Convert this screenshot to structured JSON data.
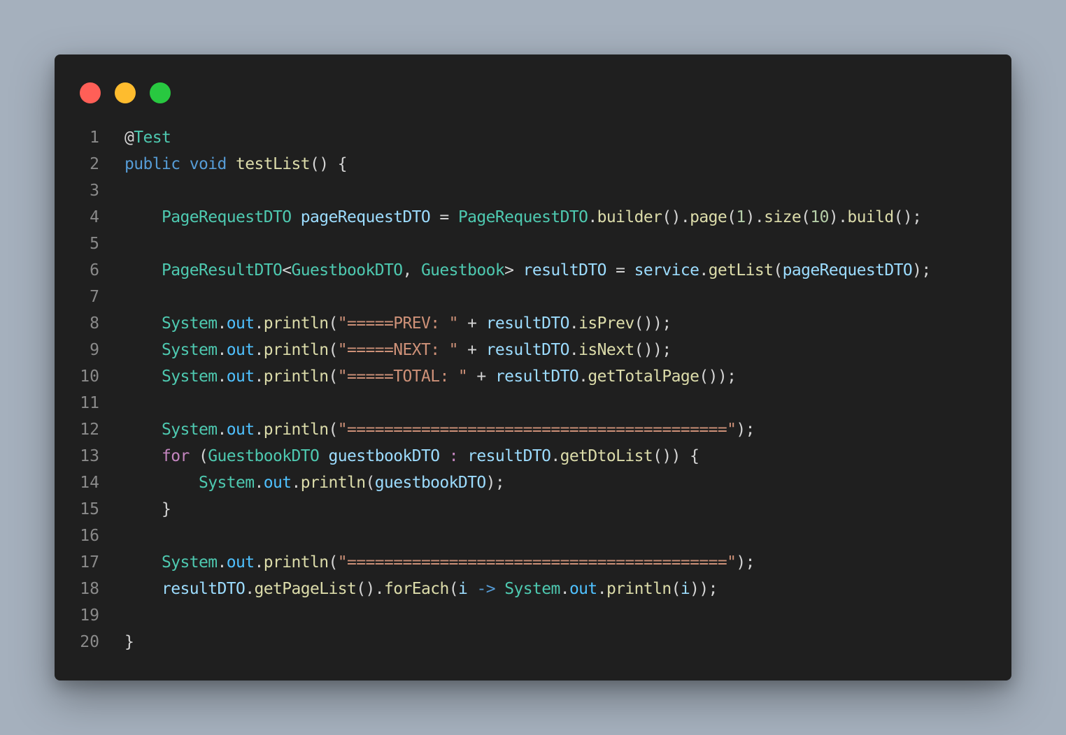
{
  "window": {
    "buttons": [
      {
        "name": "close",
        "color": "#ff5f57"
      },
      {
        "name": "minimize",
        "color": "#febc2e"
      },
      {
        "name": "maximize",
        "color": "#28c840"
      }
    ]
  },
  "colors": {
    "page_background": "#a5b0bd",
    "editor_background": "#1f1f1f",
    "keyword": "#569cd6",
    "control": "#c586c0",
    "type": "#4ec9b0",
    "function": "#dcdcaa",
    "variable": "#9cdcfe",
    "field": "#4fc1ff",
    "string": "#ce9178",
    "number": "#b5cea8",
    "punctuation": "#d4d4d4",
    "line_number": "#8a8a8a"
  },
  "code": {
    "lines": [
      {
        "n": "1",
        "tokens": [
          [
            "punc",
            "@"
          ],
          [
            "type",
            "Test"
          ]
        ]
      },
      {
        "n": "2",
        "tokens": [
          [
            "kw",
            "public"
          ],
          [
            "punc",
            " "
          ],
          [
            "kw",
            "void"
          ],
          [
            "punc",
            " "
          ],
          [
            "fn",
            "testList"
          ],
          [
            "punc",
            "() {"
          ]
        ]
      },
      {
        "n": "3",
        "tokens": []
      },
      {
        "n": "4",
        "tokens": [
          [
            "punc",
            "    "
          ],
          [
            "type",
            "PageRequestDTO"
          ],
          [
            "punc",
            " "
          ],
          [
            "var",
            "pageRequestDTO"
          ],
          [
            "punc",
            " = "
          ],
          [
            "type",
            "PageRequestDTO"
          ],
          [
            "punc",
            "."
          ],
          [
            "fn",
            "builder"
          ],
          [
            "punc",
            "()."
          ],
          [
            "fn",
            "page"
          ],
          [
            "punc",
            "("
          ],
          [
            "num",
            "1"
          ],
          [
            "punc",
            ")."
          ],
          [
            "fn",
            "size"
          ],
          [
            "punc",
            "("
          ],
          [
            "num",
            "10"
          ],
          [
            "punc",
            ")."
          ],
          [
            "fn",
            "build"
          ],
          [
            "punc",
            "();"
          ]
        ]
      },
      {
        "n": "5",
        "tokens": []
      },
      {
        "n": "6",
        "tokens": [
          [
            "punc",
            "    "
          ],
          [
            "type",
            "PageResultDTO"
          ],
          [
            "punc",
            "<"
          ],
          [
            "type",
            "GuestbookDTO"
          ],
          [
            "punc",
            ", "
          ],
          [
            "type",
            "Guestbook"
          ],
          [
            "punc",
            "> "
          ],
          [
            "var",
            "resultDTO"
          ],
          [
            "punc",
            " = "
          ],
          [
            "var",
            "service"
          ],
          [
            "punc",
            "."
          ],
          [
            "fn",
            "getList"
          ],
          [
            "punc",
            "("
          ],
          [
            "var",
            "pageRequestDTO"
          ],
          [
            "punc",
            ");"
          ]
        ]
      },
      {
        "n": "7",
        "tokens": []
      },
      {
        "n": "8",
        "tokens": [
          [
            "punc",
            "    "
          ],
          [
            "type",
            "System"
          ],
          [
            "punc",
            "."
          ],
          [
            "field",
            "out"
          ],
          [
            "punc",
            "."
          ],
          [
            "fn",
            "println"
          ],
          [
            "punc",
            "("
          ],
          [
            "str",
            "\"=====PREV: \""
          ],
          [
            "punc",
            " + "
          ],
          [
            "var",
            "resultDTO"
          ],
          [
            "punc",
            "."
          ],
          [
            "fn",
            "isPrev"
          ],
          [
            "punc",
            "());"
          ]
        ]
      },
      {
        "n": "9",
        "tokens": [
          [
            "punc",
            "    "
          ],
          [
            "type",
            "System"
          ],
          [
            "punc",
            "."
          ],
          [
            "field",
            "out"
          ],
          [
            "punc",
            "."
          ],
          [
            "fn",
            "println"
          ],
          [
            "punc",
            "("
          ],
          [
            "str",
            "\"=====NEXT: \""
          ],
          [
            "punc",
            " + "
          ],
          [
            "var",
            "resultDTO"
          ],
          [
            "punc",
            "."
          ],
          [
            "fn",
            "isNext"
          ],
          [
            "punc",
            "());"
          ]
        ]
      },
      {
        "n": "10",
        "tokens": [
          [
            "punc",
            "    "
          ],
          [
            "type",
            "System"
          ],
          [
            "punc",
            "."
          ],
          [
            "field",
            "out"
          ],
          [
            "punc",
            "."
          ],
          [
            "fn",
            "println"
          ],
          [
            "punc",
            "("
          ],
          [
            "str",
            "\"=====TOTAL: \""
          ],
          [
            "punc",
            " + "
          ],
          [
            "var",
            "resultDTO"
          ],
          [
            "punc",
            "."
          ],
          [
            "fn",
            "getTotalPage"
          ],
          [
            "punc",
            "());"
          ]
        ]
      },
      {
        "n": "11",
        "tokens": []
      },
      {
        "n": "12",
        "tokens": [
          [
            "punc",
            "    "
          ],
          [
            "type",
            "System"
          ],
          [
            "punc",
            "."
          ],
          [
            "field",
            "out"
          ],
          [
            "punc",
            "."
          ],
          [
            "fn",
            "println"
          ],
          [
            "punc",
            "("
          ],
          [
            "str",
            "\"=========================================\""
          ],
          [
            "punc",
            ");"
          ]
        ]
      },
      {
        "n": "13",
        "tokens": [
          [
            "punc",
            "    "
          ],
          [
            "ctrl",
            "for"
          ],
          [
            "punc",
            " ("
          ],
          [
            "type",
            "GuestbookDTO"
          ],
          [
            "punc",
            " "
          ],
          [
            "var",
            "guestbookDTO"
          ],
          [
            "punc",
            " "
          ],
          [
            "ctrl",
            ":"
          ],
          [
            "punc",
            " "
          ],
          [
            "var",
            "resultDTO"
          ],
          [
            "punc",
            "."
          ],
          [
            "fn",
            "getDtoList"
          ],
          [
            "punc",
            "()) {"
          ]
        ]
      },
      {
        "n": "14",
        "tokens": [
          [
            "punc",
            "        "
          ],
          [
            "type",
            "System"
          ],
          [
            "punc",
            "."
          ],
          [
            "field",
            "out"
          ],
          [
            "punc",
            "."
          ],
          [
            "fn",
            "println"
          ],
          [
            "punc",
            "("
          ],
          [
            "var",
            "guestbookDTO"
          ],
          [
            "punc",
            ");"
          ]
        ]
      },
      {
        "n": "15",
        "tokens": [
          [
            "punc",
            "    }"
          ]
        ]
      },
      {
        "n": "16",
        "tokens": []
      },
      {
        "n": "17",
        "tokens": [
          [
            "punc",
            "    "
          ],
          [
            "type",
            "System"
          ],
          [
            "punc",
            "."
          ],
          [
            "field",
            "out"
          ],
          [
            "punc",
            "."
          ],
          [
            "fn",
            "println"
          ],
          [
            "punc",
            "("
          ],
          [
            "str",
            "\"=========================================\""
          ],
          [
            "punc",
            ");"
          ]
        ]
      },
      {
        "n": "18",
        "tokens": [
          [
            "punc",
            "    "
          ],
          [
            "var",
            "resultDTO"
          ],
          [
            "punc",
            "."
          ],
          [
            "fn",
            "getPageList"
          ],
          [
            "punc",
            "()."
          ],
          [
            "fn",
            "forEach"
          ],
          [
            "punc",
            "("
          ],
          [
            "var",
            "i"
          ],
          [
            "punc",
            " "
          ],
          [
            "kw",
            "->"
          ],
          [
            "punc",
            " "
          ],
          [
            "type",
            "System"
          ],
          [
            "punc",
            "."
          ],
          [
            "field",
            "out"
          ],
          [
            "punc",
            "."
          ],
          [
            "fn",
            "println"
          ],
          [
            "punc",
            "("
          ],
          [
            "var",
            "i"
          ],
          [
            "punc",
            "));"
          ]
        ]
      },
      {
        "n": "19",
        "tokens": []
      },
      {
        "n": "20",
        "tokens": [
          [
            "punc",
            "}"
          ]
        ]
      }
    ]
  }
}
